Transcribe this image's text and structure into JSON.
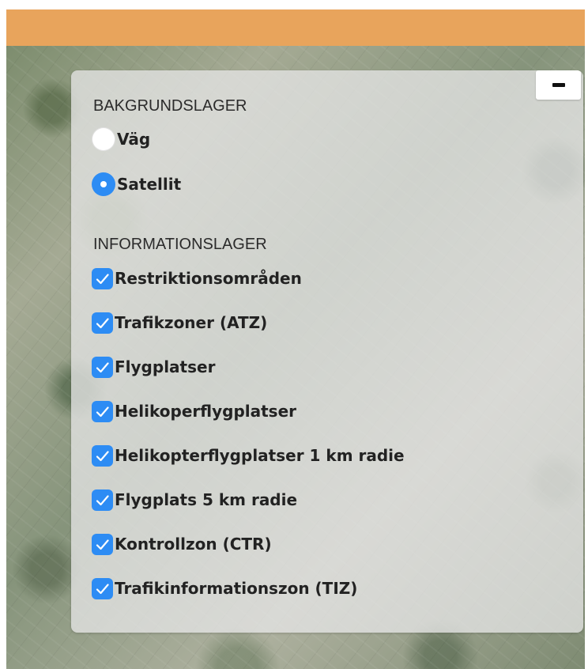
{
  "layer_panel": {
    "collapse_label": "−",
    "background_section": {
      "title": "BAKGRUNDSLAGER",
      "options": [
        {
          "label": "Väg",
          "selected": false
        },
        {
          "label": "Satellit",
          "selected": true
        }
      ]
    },
    "information_section": {
      "title": "INFORMATIONSLAGER",
      "layers": [
        {
          "label": "Restriktionsområden",
          "checked": true
        },
        {
          "label": "Trafikzoner (ATZ)",
          "checked": true
        },
        {
          "label": "Flygplatser",
          "checked": true
        },
        {
          "label": "Helikoperflygplatser",
          "checked": true
        },
        {
          "label": "Helikopterflygplatser 1 km radie",
          "checked": true
        },
        {
          "label": "Flygplats 5 km radie",
          "checked": true
        },
        {
          "label": "Kontrollzon (CTR)",
          "checked": true
        },
        {
          "label": "Trafikinformationszon (TIZ)",
          "checked": true
        }
      ]
    }
  },
  "colors": {
    "top_bar": "#e8a45c",
    "accent": "#2d8cf4",
    "panel": "#e4e4e4"
  },
  "icons": {
    "collapse": "minus-icon",
    "radio": "radio-icon",
    "checkbox": "checkmark-icon"
  }
}
